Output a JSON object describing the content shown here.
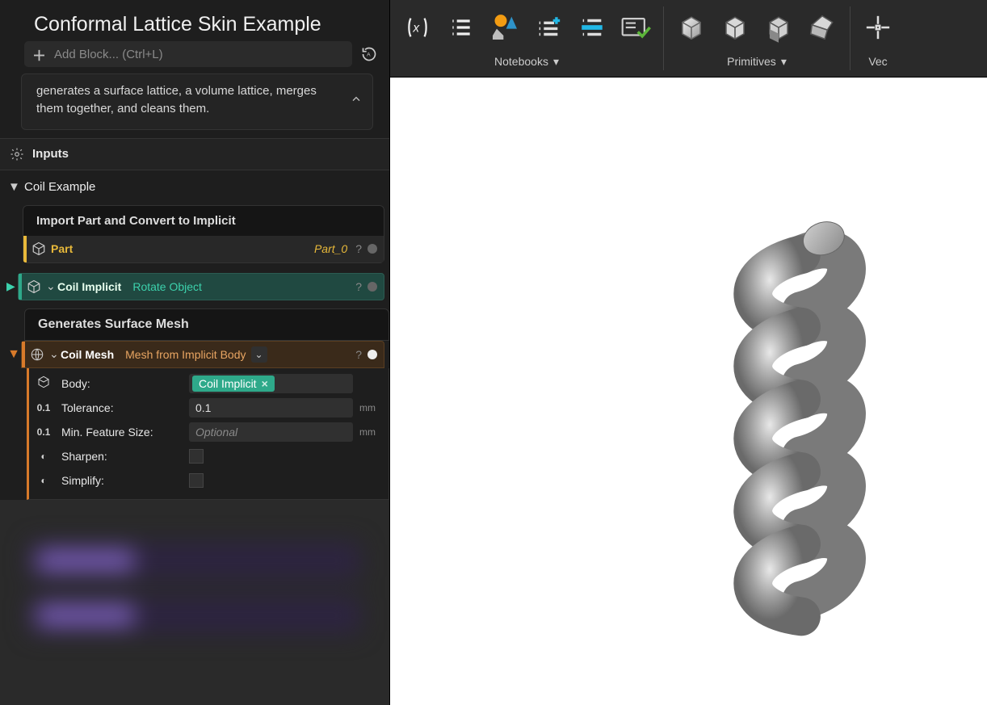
{
  "panel": {
    "title": "Conformal Lattice Skin Example",
    "add_block_placeholder": "Add Block... (Ctrl+L)",
    "info_text": "generates a surface lattice, a volume lattice, merges them together, and cleans them.",
    "inputs_label": "Inputs"
  },
  "tree": {
    "section": "Coil Example",
    "import_block": {
      "header": "Import Part and Convert to Implicit",
      "part": {
        "name": "Part",
        "value": "Part_0"
      }
    },
    "coil_implicit": {
      "name": "Coil Implicit",
      "type": "Rotate Object"
    },
    "mesh_block": {
      "header": "Generates Surface Mesh",
      "row": {
        "name": "Coil Mesh",
        "type": "Mesh from Implicit Body"
      },
      "params": {
        "body": {
          "label": "Body:",
          "value": "Coil Implicit"
        },
        "tolerance": {
          "label": "Tolerance:",
          "value": "0.1",
          "unit": "mm"
        },
        "min_feature": {
          "label": "Min. Feature Size:",
          "placeholder": "Optional",
          "unit": "mm"
        },
        "sharpen": {
          "label": "Sharpen:"
        },
        "simplify": {
          "label": "Simplify:"
        }
      }
    }
  },
  "toolbar": {
    "notebooks_label": "Notebooks",
    "primitives_label": "Primitives",
    "vec_label": "Vec"
  }
}
